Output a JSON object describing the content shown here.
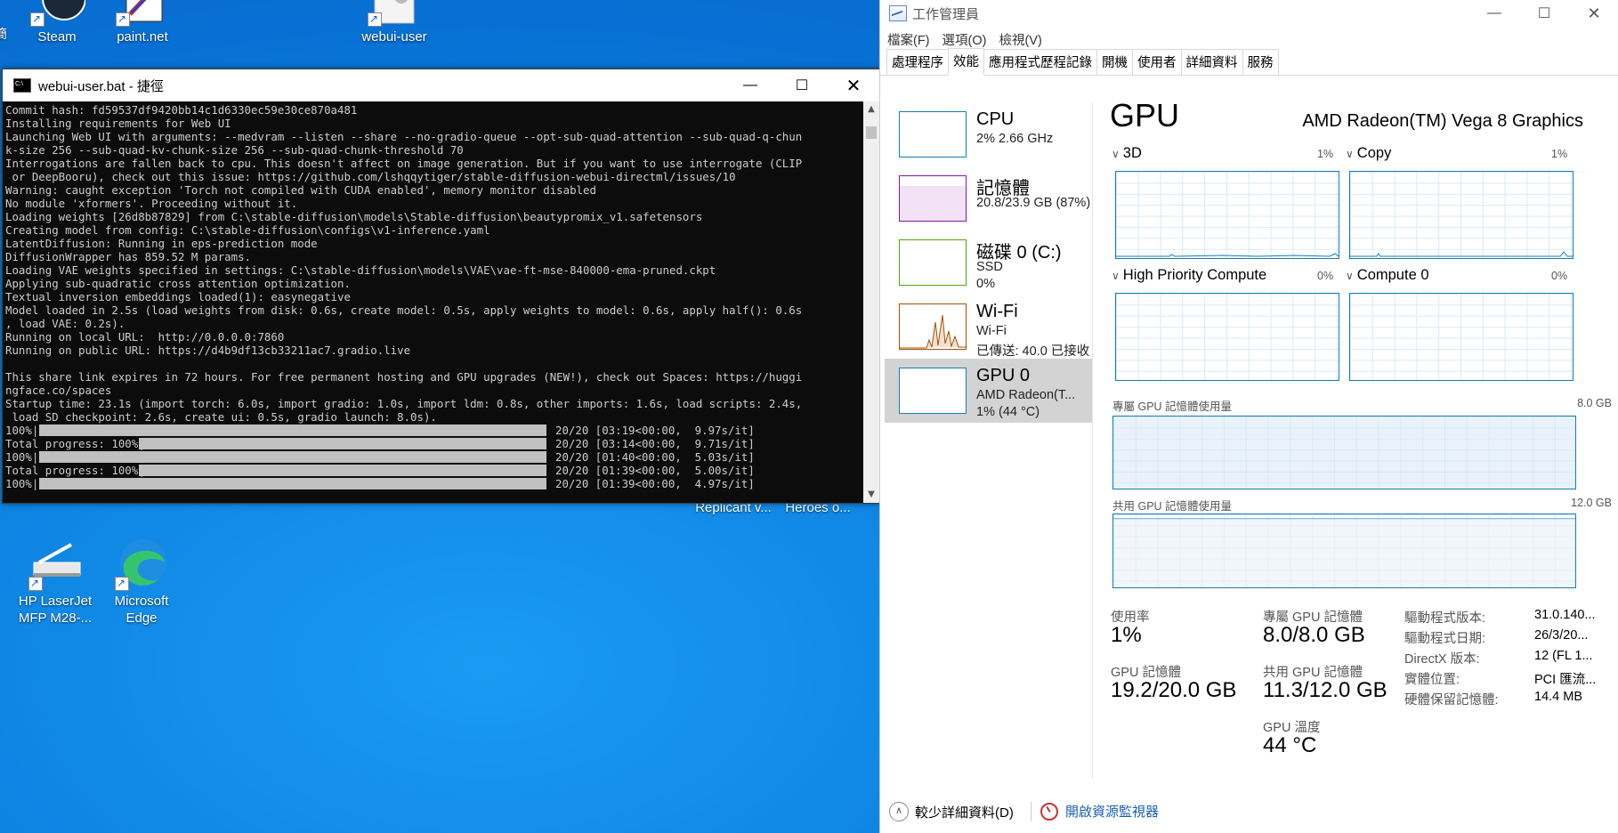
{
  "desktop": {
    "icons": [
      {
        "label": "Steam"
      },
      {
        "label": "paint.net"
      },
      {
        "label": "webui-user"
      },
      {
        "label": "HP LaserJet MFP M28-..."
      },
      {
        "label": "Microsoft Edge"
      },
      {
        "label": "Replicant v..."
      },
      {
        "label": "Heroes o..."
      }
    ],
    "left_edge_glyph": "簡"
  },
  "console": {
    "title": "webui-user.bat - 捷徑",
    "lines": [
      "Commit hash: fd59537df9420bb14c1d6330ec59e30ce870a481",
      "Installing requirements for Web UI",
      "Launching Web UI with arguments: --medvram --listen --share --no-gradio-queue --opt-sub-quad-attention --sub-quad-q-chun",
      "k-size 256 --sub-quad-kv-chunk-size 256 --sub-quad-chunk-threshold 70",
      "Interrogations are fallen back to cpu. This doesn't affect on image generation. But if you want to use interrogate (CLIP",
      " or DeepBooru), check out this issue: https://github.com/lshqqytiger/stable-diffusion-webui-directml/issues/10",
      "Warning: caught exception 'Torch not compiled with CUDA enabled', memory monitor disabled",
      "No module 'xformers'. Proceeding without it.",
      "Loading weights [26d8b87829] from C:\\stable-diffusion\\models\\Stable-diffusion\\beautypromix_v1.safetensors",
      "Creating model from config: C:\\stable-diffusion\\configs\\v1-inference.yaml",
      "LatentDiffusion: Running in eps-prediction mode",
      "DiffusionWrapper has 859.52 M params.",
      "Loading VAE weights specified in settings: C:\\stable-diffusion\\models\\VAE\\vae-ft-mse-840000-ema-pruned.ckpt",
      "Applying sub-quadratic cross attention optimization.",
      "Textual inversion embeddings loaded(1): easynegative",
      "Model loaded in 2.5s (load weights from disk: 0.6s, create model: 0.5s, apply weights to model: 0.6s, apply half(): 0.6s",
      ", load VAE: 0.2s).",
      "Running on local URL:  http://0.0.0.0:7860",
      "Running on public URL: https://d4b9df13cb33211ac7.gradio.live",
      "",
      "This share link expires in 72 hours. For free permanent hosting and GPU upgrades (NEW!), check out Spaces: https://huggi",
      "ngface.co/spaces",
      "Startup time: 23.1s (import torch: 6.0s, import gradio: 1.0s, import ldm: 0.8s, other imports: 1.6s, load scripts: 2.4s,",
      " load SD checkpoint: 2.6s, create ui: 0.5s, gradio launch: 8.0s)."
    ],
    "progress_lines": [
      {
        "prefix": "100%|",
        "suffix": "20/20 [03:19<00:00,  9.97s/it]"
      },
      {
        "prefix": "Total progress: 100%|",
        "suffix": "20/20 [03:14<00:00,  9.71s/it]"
      },
      {
        "prefix": "100%|",
        "suffix": "20/20 [01:40<00:00,  5.03s/it]"
      },
      {
        "prefix": "Total progress: 100%|",
        "suffix": "20/20 [01:39<00:00,  5.00s/it]"
      },
      {
        "prefix": "100%|",
        "suffix": "20/20 [01:39<00:00,  4.97s/it]"
      }
    ],
    "progress_fraction": 1.0
  },
  "taskmgr": {
    "title": "工作管理員",
    "menu": [
      "檔案(F)",
      "選項(O)",
      "檢視(V)"
    ],
    "tabs": [
      "處理程序",
      "效能",
      "應用程式歷程記錄",
      "開機",
      "使用者",
      "詳細資料",
      "服務"
    ],
    "active_tab": "效能",
    "sidebar": [
      {
        "name": "CPU",
        "line1": "2% 2.66 GHz",
        "line2": "",
        "color": "#117dbb"
      },
      {
        "name": "記憶體",
        "line1": "20.8/23.9 GB (87%)",
        "line2": "",
        "color": "#8b12ae"
      },
      {
        "name": "磁碟 0 (C:)",
        "line1": "SSD",
        "line2": "0%",
        "color": "#4da60c"
      },
      {
        "name": "Wi-Fi",
        "line1": "Wi-Fi",
        "line2": "已傳送: 40.0 已接收",
        "color": "#a74f01"
      },
      {
        "name": "GPU 0",
        "line1": "AMD Radeon(T...",
        "line2": "1% (44 °C)",
        "color": "#117dbb"
      }
    ],
    "gpu": {
      "title": "GPU",
      "model": "AMD Radeon(TM) Vega 8 Graphics",
      "engines": [
        {
          "name": "3D",
          "pct": "1%"
        },
        {
          "name": "Copy",
          "pct": "1%"
        },
        {
          "name": "High Priority Compute",
          "pct": "0%"
        },
        {
          "name": "Compute 0",
          "pct": "0%"
        }
      ],
      "dedicated_label": "專屬 GPU 記憶體使用量",
      "dedicated_max": "8.0 GB",
      "shared_label": "共用 GPU 記憶體使用量",
      "shared_max": "12.0 GB",
      "stats": {
        "usage_label": "使用率",
        "usage": "1%",
        "gpu_mem_label": "GPU 記憶體",
        "gpu_mem": "19.2/20.0 GB",
        "ded_mem_label": "專屬 GPU 記憶體",
        "ded_mem": "8.0/8.0 GB",
        "shared_mem_label": "共用 GPU 記憶體",
        "shared_mem": "11.3/12.0 GB",
        "temp_label": "GPU 溫度",
        "temp": "44 °C"
      },
      "details": [
        {
          "key": "驅動程式版本:",
          "val": "31.0.140..."
        },
        {
          "key": "驅動程式日期:",
          "val": "26/3/20..."
        },
        {
          "key": "DirectX 版本:",
          "val": "12 (FL 1..."
        },
        {
          "key": "實體位置:",
          "val": "PCI 匯流..."
        },
        {
          "key": "硬體保留記憶體:",
          "val": "14.4 MB"
        }
      ]
    },
    "footer": {
      "fewer_details": "較少詳細資料(D)",
      "resource_monitor": "開啟資源監視器"
    }
  }
}
